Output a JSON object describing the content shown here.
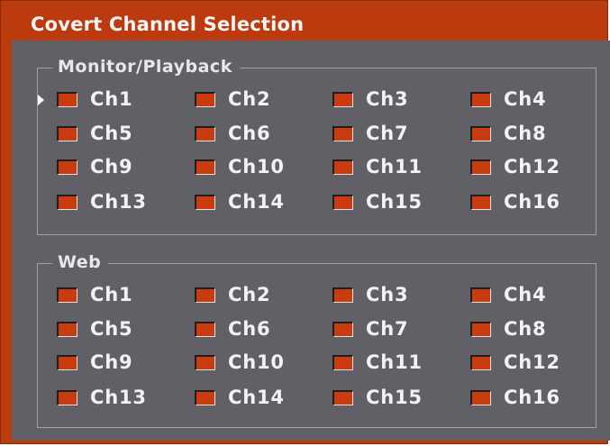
{
  "dialog": {
    "title": "Covert Channel Selection"
  },
  "groups": [
    {
      "legend": "Monitor/Playback",
      "channels": [
        "Ch1",
        "Ch2",
        "Ch3",
        "Ch4",
        "Ch5",
        "Ch6",
        "Ch7",
        "Ch8",
        "Ch9",
        "Ch10",
        "Ch11",
        "Ch12",
        "Ch13",
        "Ch14",
        "Ch15",
        "Ch16"
      ]
    },
    {
      "legend": "Web",
      "channels": [
        "Ch1",
        "Ch2",
        "Ch3",
        "Ch4",
        "Ch5",
        "Ch6",
        "Ch7",
        "Ch8",
        "Ch9",
        "Ch10",
        "Ch11",
        "Ch12",
        "Ch13",
        "Ch14",
        "Ch15",
        "Ch16"
      ]
    }
  ],
  "colors": {
    "frame": "#bb3a0e",
    "panel": "#606066",
    "checkbox_fill": "#c83c10"
  },
  "focus_indicator": {
    "group": 0,
    "channel": 0,
    "icon": "selection-arrow-icon"
  }
}
